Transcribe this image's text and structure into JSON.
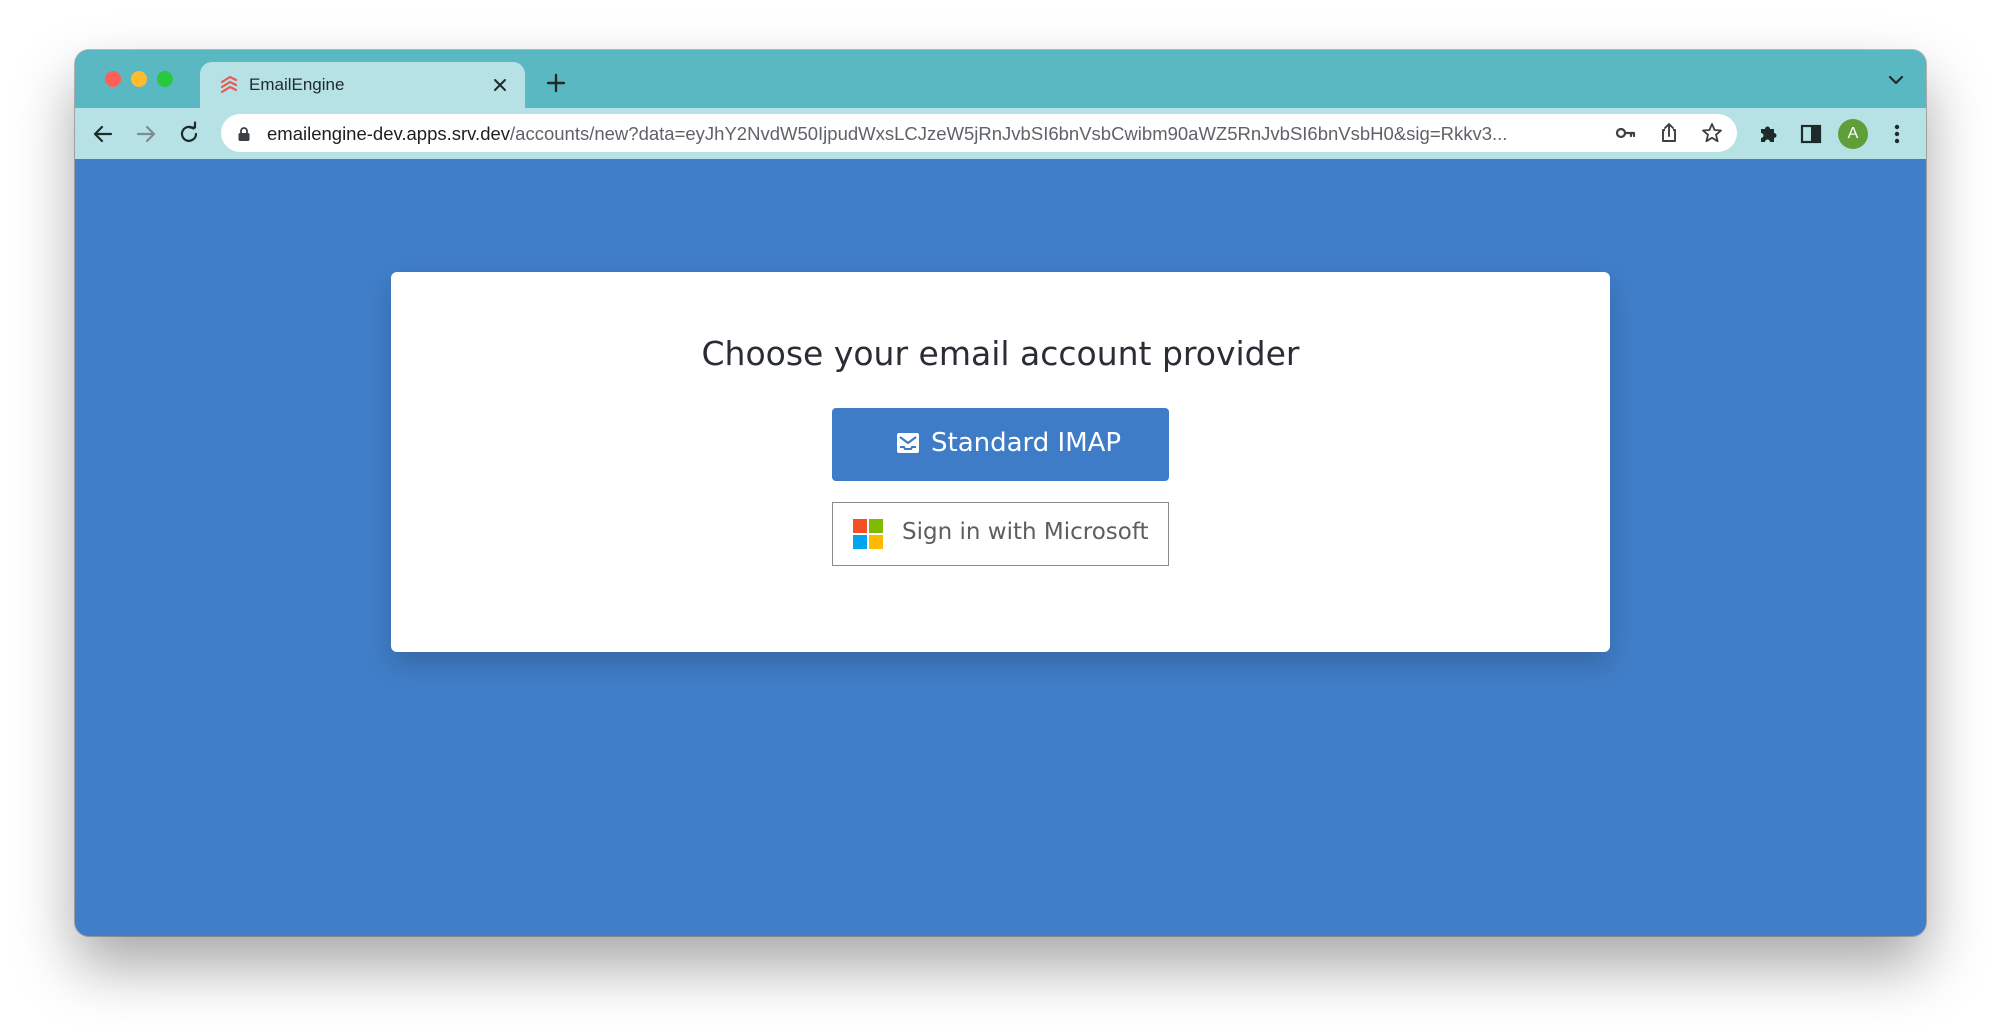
{
  "browser": {
    "tab": {
      "title": "EmailEngine",
      "favicon": "emailengine-logo-icon",
      "close_icon": "close-icon"
    },
    "new_tab_icon": "plus-icon",
    "tab_list_icon": "chevron-down-icon",
    "toolbar": {
      "back_icon": "arrow-left-icon",
      "forward_icon": "arrow-right-icon",
      "reload_icon": "reload-icon",
      "url_host": "emailengine-dev.apps.srv.dev",
      "url_path": "/accounts/new?data=eyJhY2NvdW50IjpudWxsLCJzeW5jRnJvbSI6bnVsbCwibm90aWZ5RnJvbSI6bnVsbH0&sig=Rkkv3...",
      "lock_icon": "lock-icon",
      "key_icon": "key-icon",
      "share_icon": "share-icon",
      "star_icon": "star-icon",
      "extensions_icon": "puzzle-icon",
      "side_panel_icon": "side-panel-icon",
      "profile_initial": "A",
      "menu_icon": "more-vert-icon"
    }
  },
  "page": {
    "title": "Choose your email account provider",
    "imap_button": {
      "label": "Standard IMAP",
      "icon": "envelope-icon"
    },
    "microsoft_button": {
      "label": "Sign in with Microsoft",
      "icon": "microsoft-logo-icon"
    }
  },
  "colors": {
    "titlebar": "#5ab8c2",
    "toolbar": "#b6e2e6",
    "page_background": "#407ec9",
    "primary_button": "#3f7cc7",
    "avatar": "#5e9f3a"
  }
}
